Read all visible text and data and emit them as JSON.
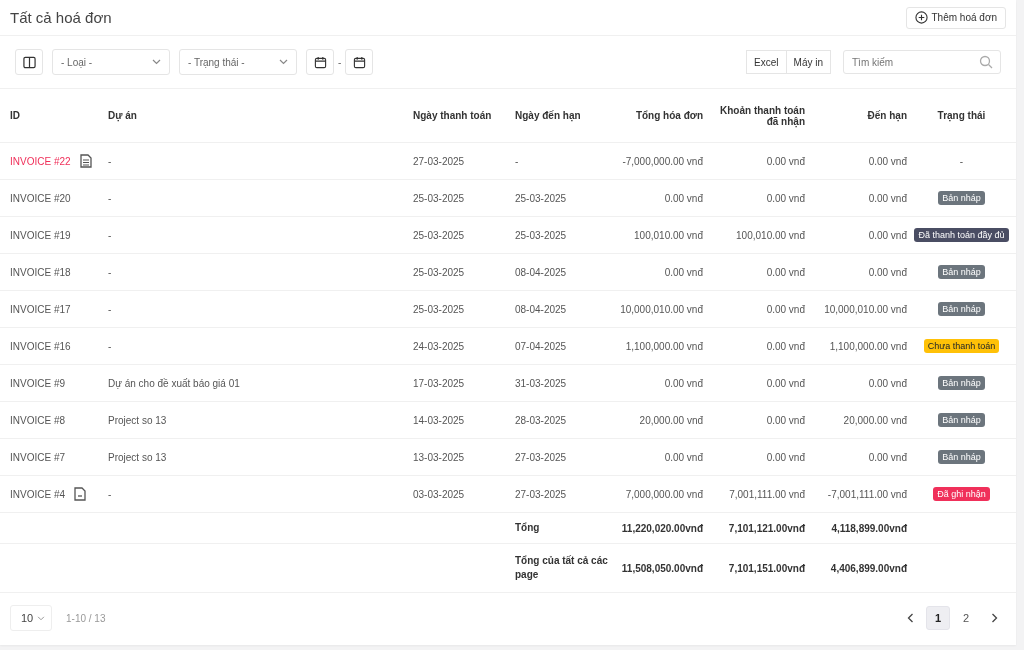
{
  "title": "Tất cả hoá đơn",
  "add_button": "Thêm hoá đơn",
  "filters": {
    "type_placeholder": "- Loại -",
    "status_placeholder": "- Trạng thái -",
    "date_separator": "-",
    "export_buttons": [
      "Excel",
      "Máy in"
    ],
    "search": {
      "placeholder": "Tìm kiếm"
    }
  },
  "table": {
    "columns": [
      "ID",
      "Dự án",
      "Ngày thanh toán",
      "Ngày đến hạn",
      "Tổng hóa đơn",
      "Khoản thanh toán đã nhận",
      "Đến hạn",
      "Trạng thái"
    ],
    "rows": [
      {
        "id": "INVOICE #22",
        "highlighted": true,
        "kind": "attachment",
        "project": "-",
        "payment_date": "27-03-2025",
        "due_date": "-",
        "total": "-7,000,000.00 vnđ",
        "received": "0.00 vnđ",
        "due": "0.00 vnđ",
        "status": {
          "kind": "text",
          "label": "-"
        }
      },
      {
        "id": "INVOICE #20",
        "highlighted": false,
        "project": "-",
        "payment_date": "25-03-2025",
        "due_date": "25-03-2025",
        "total": "0.00 vnđ",
        "received": "0.00 vnđ",
        "due": "0.00 vnđ",
        "status": {
          "kind": "badge",
          "label": "Bản nháp",
          "color": "#6c757d"
        }
      },
      {
        "id": "INVOICE #19",
        "highlighted": false,
        "project": "-",
        "payment_date": "25-03-2025",
        "due_date": "25-03-2025",
        "total": "100,010.00 vnđ",
        "received": "100,010.00 vnđ",
        "due": "0.00 vnđ",
        "status": {
          "kind": "badge",
          "label": "Đã thanh toán đầy đủ",
          "color": "#4a4d63"
        }
      },
      {
        "id": "INVOICE #18",
        "highlighted": false,
        "project": "-",
        "payment_date": "25-03-2025",
        "due_date": "08-04-2025",
        "total": "0.00 vnđ",
        "received": "0.00 vnđ",
        "due": "0.00 vnđ",
        "status": {
          "kind": "badge",
          "label": "Bản nháp",
          "color": "#6c757d"
        }
      },
      {
        "id": "INVOICE #17",
        "highlighted": false,
        "project": "-",
        "payment_date": "25-03-2025",
        "due_date": "08-04-2025",
        "total": "10,000,010.00 vnđ",
        "received": "0.00 vnđ",
        "due": "10,000,010.00 vnđ",
        "status": {
          "kind": "badge",
          "label": "Bản nháp",
          "color": "#6c757d"
        }
      },
      {
        "id": "INVOICE #16",
        "highlighted": false,
        "project": "-",
        "payment_date": "24-03-2025",
        "due_date": "07-04-2025",
        "total": "1,100,000.00 vnđ",
        "received": "0.00 vnđ",
        "due": "1,100,000.00 vnđ",
        "status": {
          "kind": "badge",
          "label": "Chưa thanh toán",
          "color": "#ffc107"
        }
      },
      {
        "id": "INVOICE #9",
        "highlighted": false,
        "project": "Dự án cho đề xuất báo giá 01",
        "payment_date": "17-03-2025",
        "due_date": "31-03-2025",
        "total": "0.00 vnđ",
        "received": "0.00 vnđ",
        "due": "0.00 vnđ",
        "status": {
          "kind": "badge",
          "label": "Bản nháp",
          "color": "#6c757d"
        }
      },
      {
        "id": "INVOICE #8",
        "highlighted": false,
        "project": "Project so 13",
        "payment_date": "14-03-2025",
        "due_date": "28-03-2025",
        "total": "20,000.00 vnđ",
        "received": "0.00 vnđ",
        "due": "20,000.00 vnđ",
        "status": {
          "kind": "badge",
          "label": "Bản nháp",
          "color": "#6c757d"
        }
      },
      {
        "id": "INVOICE #7",
        "highlighted": false,
        "project": "Project so 13",
        "payment_date": "13-03-2025",
        "due_date": "27-03-2025",
        "total": "0.00 vnđ",
        "received": "0.00 vnđ",
        "due": "0.00 vnđ",
        "status": {
          "kind": "badge",
          "label": "Bản nháp",
          "color": "#6c757d"
        }
      },
      {
        "id": "INVOICE #4",
        "highlighted": false,
        "kind": "note",
        "project": "-",
        "payment_date": "03-03-2025",
        "due_date": "27-03-2025",
        "total": "7,000,000.00 vnđ",
        "received": "7,001,111.00 vnđ",
        "due": "-7,001,111.00 vnđ",
        "status": {
          "kind": "badge",
          "label": "Đã ghi nhận",
          "color": "#f0305a"
        }
      }
    ],
    "totals": [
      {
        "label": "Tổng",
        "total": "11,220,020.00vnđ",
        "received": "7,101,121.00vnđ",
        "due": "4,118,899.00vnđ"
      },
      {
        "label": "Tổng của tất cả các page",
        "total": "11,508,050.00vnđ",
        "received": "7,101,151.00vnđ",
        "due": "4,406,899.00vnđ"
      }
    ]
  },
  "pagination": {
    "page_size": "10",
    "range": "1-10 / 13",
    "pages": [
      {
        "label": "1",
        "selected": true
      },
      {
        "label": "2",
        "selected": false
      }
    ]
  }
}
